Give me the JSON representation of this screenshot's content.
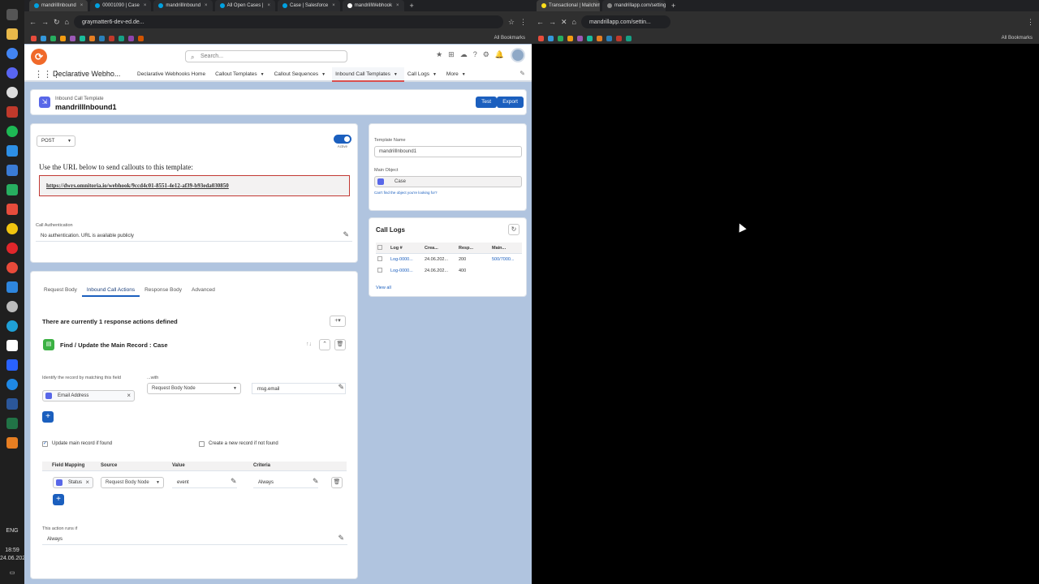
{
  "left_window": {
    "tabs": [
      {
        "label": "mandrillInbound",
        "color": "#00a1e0",
        "active": true
      },
      {
        "label": "00001090 | Case",
        "color": "#00a1e0",
        "active": false
      },
      {
        "label": "mandrillInbound",
        "color": "#00a1e0",
        "active": false
      },
      {
        "label": "All Open Cases |",
        "color": "#00a1e0",
        "active": false
      },
      {
        "label": "Case | Salesforce",
        "color": "#00a1e0",
        "active": false
      },
      {
        "label": "mandrillWebhook",
        "color": "#ffffff",
        "active": false
      }
    ],
    "url": "graymatter6-dev-ed.de...",
    "bookmarks_label": "All Bookmarks"
  },
  "right_window": {
    "tabs": [
      {
        "label": "Transactional | Mailchimp",
        "color": "#ffe01b",
        "active": true
      },
      {
        "label": "mandrillapp.com/settings/weba",
        "color": "#888888",
        "active": false
      }
    ],
    "url": "mandrillapp.com/settin...",
    "bookmarks_label": "All Bookmarks"
  },
  "header": {
    "search_placeholder": "Search..."
  },
  "nav": {
    "app_name": "Declarative Webho...",
    "items": [
      {
        "label": "Declarative Webhooks Home",
        "caret": false,
        "active": false
      },
      {
        "label": "Callout Templates",
        "caret": true,
        "active": false
      },
      {
        "label": "Callout Sequences",
        "caret": true,
        "active": false
      },
      {
        "label": "Inbound Call Templates",
        "caret": true,
        "active": true
      },
      {
        "label": "Call Logs",
        "caret": true,
        "active": false
      },
      {
        "label": "More",
        "caret": true,
        "active": false
      }
    ]
  },
  "record": {
    "type": "Inbound Call Template",
    "name": "mandrillInbound1",
    "test_label": "Test",
    "export_label": "Export"
  },
  "config": {
    "method": "POST",
    "active_label": "Active",
    "use_url_text": "Use the URL below to send callouts to this template:",
    "webhook_url": "https://dwrs.omnitoria.io/webhook/9ccd4c01-8551-4e12-af39-b93eda030850",
    "auth_label": "Call Authentication",
    "auth_value": "No authentication. URL is available publicly"
  },
  "sidebar": {
    "template_name_label": "Template Name",
    "template_name_value": "mandrillInbound1",
    "main_object_label": "Main Object",
    "main_object_value": "Case",
    "cant_find": "Can't find the object you're looking for?"
  },
  "call_logs": {
    "title": "Call Logs",
    "columns": [
      "Log #",
      "Crea...",
      "Resp...",
      "Main..."
    ],
    "rows": [
      {
        "log": "Log-0000...",
        "created": "24.06.202...",
        "response": "200",
        "main": "500/7000..."
      },
      {
        "log": "Log-0000...",
        "created": "24.06.202...",
        "response": "400",
        "main": ""
      }
    ],
    "view_all": "View all"
  },
  "subtabs": [
    {
      "label": "Request Body",
      "active": false
    },
    {
      "label": "Inbound Call Actions",
      "active": true
    },
    {
      "label": "Response Body",
      "active": false
    },
    {
      "label": "Advanced",
      "active": false
    }
  ],
  "actions": {
    "summary": "There are currently 1 response actions defined",
    "action_title": "Find / Update the Main Record : Case",
    "identify_label": "Identify the record by matching this field",
    "with_label": "...with",
    "match_field": "Email Address",
    "source": "Request Body Node",
    "source_value": "msg.email",
    "update_if_found": "Update main record if found",
    "create_if_not_found": "Create a new record if not found",
    "mapping_headers": [
      "Field Mapping",
      "Source",
      "Value",
      "Criteria"
    ],
    "mapping_row": {
      "field": "Status",
      "source": "Request Body Node",
      "value": "event",
      "criteria": "Always"
    },
    "runs_if_label": "This action runs if",
    "runs_if_value": "Always"
  },
  "taskbar": {
    "lang": "ENG",
    "time": "18:59",
    "date": "24.06.2024"
  }
}
